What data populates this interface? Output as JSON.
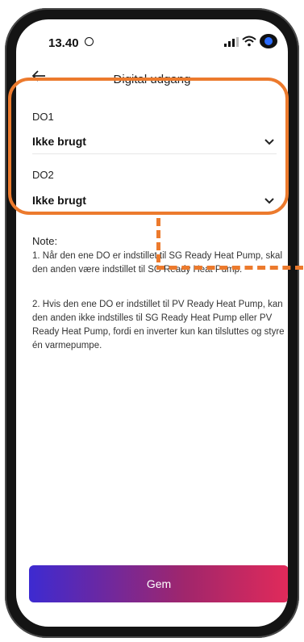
{
  "status_bar": {
    "time": "13.40"
  },
  "header": {
    "title": "Digital udgang"
  },
  "fields": [
    {
      "label": "DO1",
      "value": "Ikke brugt"
    },
    {
      "label": "DO2",
      "value": "Ikke brugt"
    }
  ],
  "notes": {
    "title": "Note:",
    "items": [
      "1. Når den ene DO er indstillet til SG Ready Heat Pump, skal den anden være indstillet til SG Ready Heat Pump.",
      "2. Hvis den ene DO er indstillet til PV Ready Heat Pump, kan den anden ikke indstilles til SG Ready Heat Pump eller PV Ready Heat Pump, fordi en inverter kun kan tilsluttes og styre én varmepumpe."
    ]
  },
  "footer": {
    "save_label": "Gem"
  },
  "colors": {
    "highlight": "#ec7a2d",
    "button_start": "#3d2ad1",
    "button_end": "#e12a5a"
  }
}
